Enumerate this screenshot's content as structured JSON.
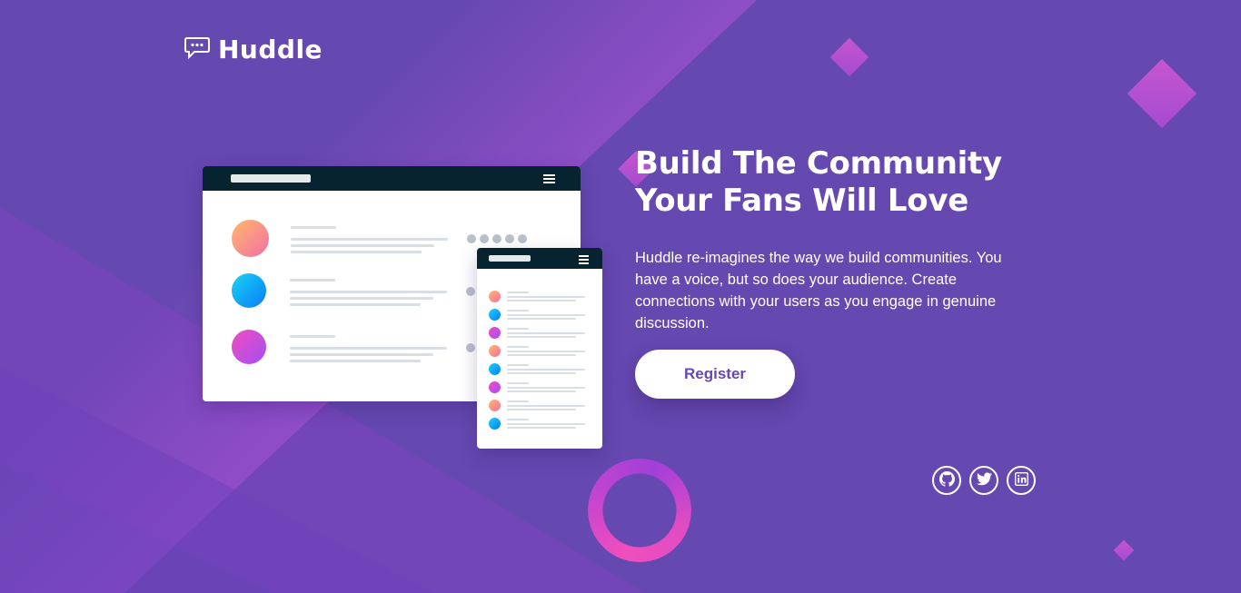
{
  "brand": {
    "name": "Huddle"
  },
  "hero": {
    "title_line1": "Build The Community",
    "title_line2": "Your Fans Will Love",
    "description": "Huddle re-imagines the way we build communities. You have a voice, but so does your audience. Create connections with your users as you engage in genuine discussion.",
    "cta_label": "Register"
  },
  "social": [
    {
      "icon": "github-icon"
    },
    {
      "icon": "twitter-icon"
    },
    {
      "icon": "linkedin-icon"
    }
  ],
  "colors": {
    "background": "#6548b0",
    "accent_pink": "#f04ebd",
    "mock_bar": "#06232f",
    "button_text": "#6548b0"
  }
}
